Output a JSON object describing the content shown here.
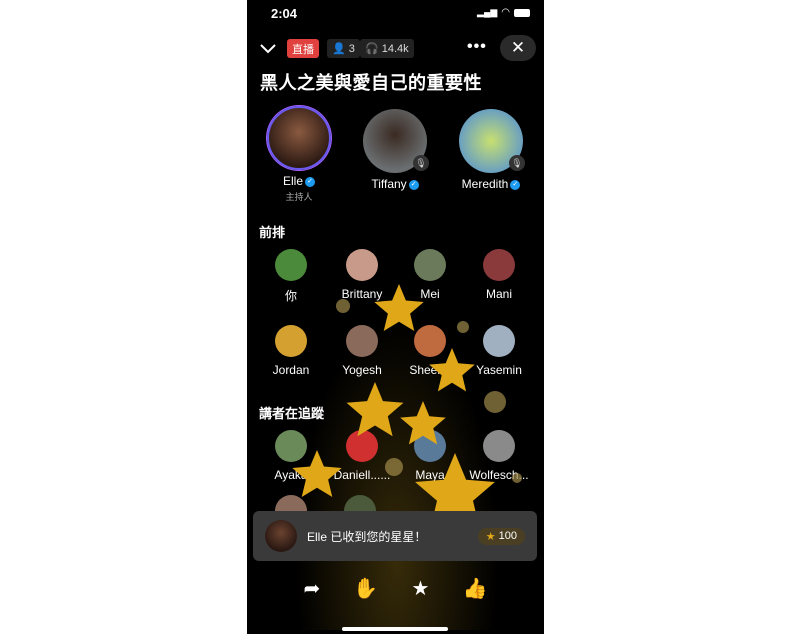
{
  "status_bar": {
    "time": "2:04"
  },
  "header": {
    "live_label": "直播",
    "speakers_count": "3",
    "listeners_count": "14.4k",
    "title": "黑人之美與愛自己的重要性"
  },
  "speakers": [
    {
      "name": "Elle",
      "role": "主持人",
      "verified": true,
      "color": "#6a4028"
    },
    {
      "name": "Tiffany",
      "verified": true,
      "muted": true,
      "color": "#55585a"
    },
    {
      "name": "Meredith",
      "verified": true,
      "muted": true,
      "color": "#7fa8b8"
    }
  ],
  "front_row": {
    "label": "前排",
    "people": [
      {
        "name": "你",
        "color": "#4b8a3a"
      },
      {
        "name": "Brittany",
        "color": "#c89a8a"
      },
      {
        "name": "Mei",
        "color": "#6a7a5a"
      },
      {
        "name": "Mani",
        "color": "#8a3a3a"
      },
      {
        "name": "Jordan",
        "color": "#d4a030"
      },
      {
        "name": "Yogesh",
        "color": "#8a6a5a"
      },
      {
        "name": "Sheena",
        "color": "#c06a40"
      },
      {
        "name": "Yasemin",
        "color": "#a0b0c0"
      }
    ]
  },
  "followed": {
    "label": "講者在追蹤",
    "people": [
      {
        "name": "Ayaka",
        "color": "#6a8a5a"
      },
      {
        "name": "Daniell......",
        "color": "#d03030"
      },
      {
        "name": "Maya",
        "color": "#5a7a9a"
      },
      {
        "name": "Wolfesch...",
        "color": "#8a8a8a"
      }
    ]
  },
  "toast": {
    "message": "Elle 已收到您的星星！",
    "stars": "100"
  },
  "actions": [
    "share",
    "raise-hand",
    "send-star",
    "like"
  ],
  "colors": {
    "live": "#e0403e",
    "verified": "#1d9bf0",
    "star": "#e0a818"
  }
}
